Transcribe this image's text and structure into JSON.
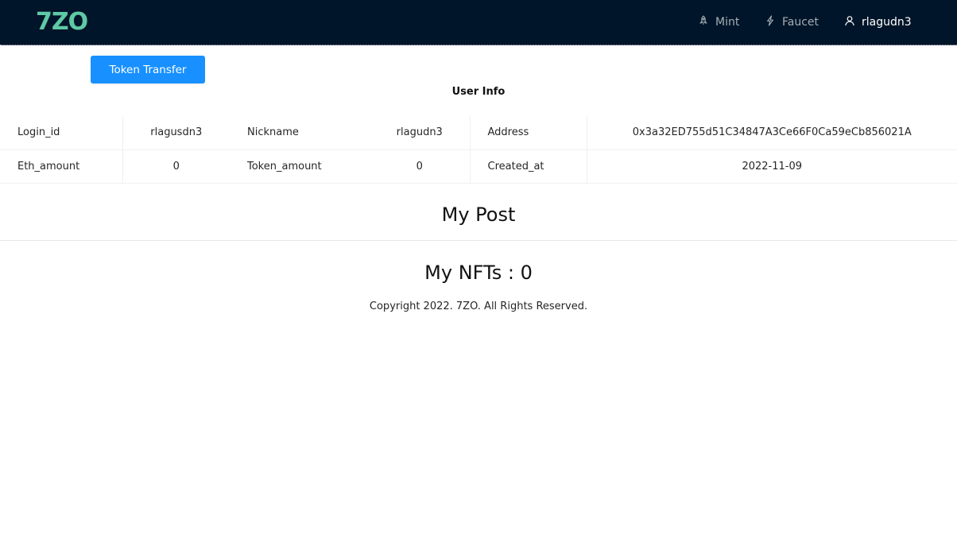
{
  "header": {
    "logo": "7ZO",
    "nav": [
      {
        "label": "Mint",
        "icon": "rocket-icon"
      },
      {
        "label": "Faucet",
        "icon": "thunderbolt-icon"
      },
      {
        "label": "rlagudn3",
        "icon": "user-icon"
      }
    ],
    "colors": {
      "background": "#001529",
      "logo": "#5fc9a5"
    }
  },
  "actions": {
    "token_transfer_label": "Token Transfer"
  },
  "user_info": {
    "title": "User Info",
    "rows": [
      [
        {
          "key": "Login_id",
          "value": "rlagusdn3"
        },
        {
          "key": "Nickname",
          "value": "rlagudn3"
        },
        {
          "key": "Address",
          "value": "0x3a32ED755d51C34847A3Ce66F0Ca59eCb856021A"
        }
      ],
      [
        {
          "key": "Eth_amount",
          "value": "0"
        },
        {
          "key": "Token_amount",
          "value": "0"
        },
        {
          "key": "Created_at",
          "value": "2022-11-09"
        }
      ]
    ]
  },
  "my_post": {
    "title": "My Post"
  },
  "my_nfts": {
    "title": "My NFTs : 0"
  },
  "footer": {
    "copyright": "Copyright 2022. 7ZO. All Rights Reserved."
  }
}
